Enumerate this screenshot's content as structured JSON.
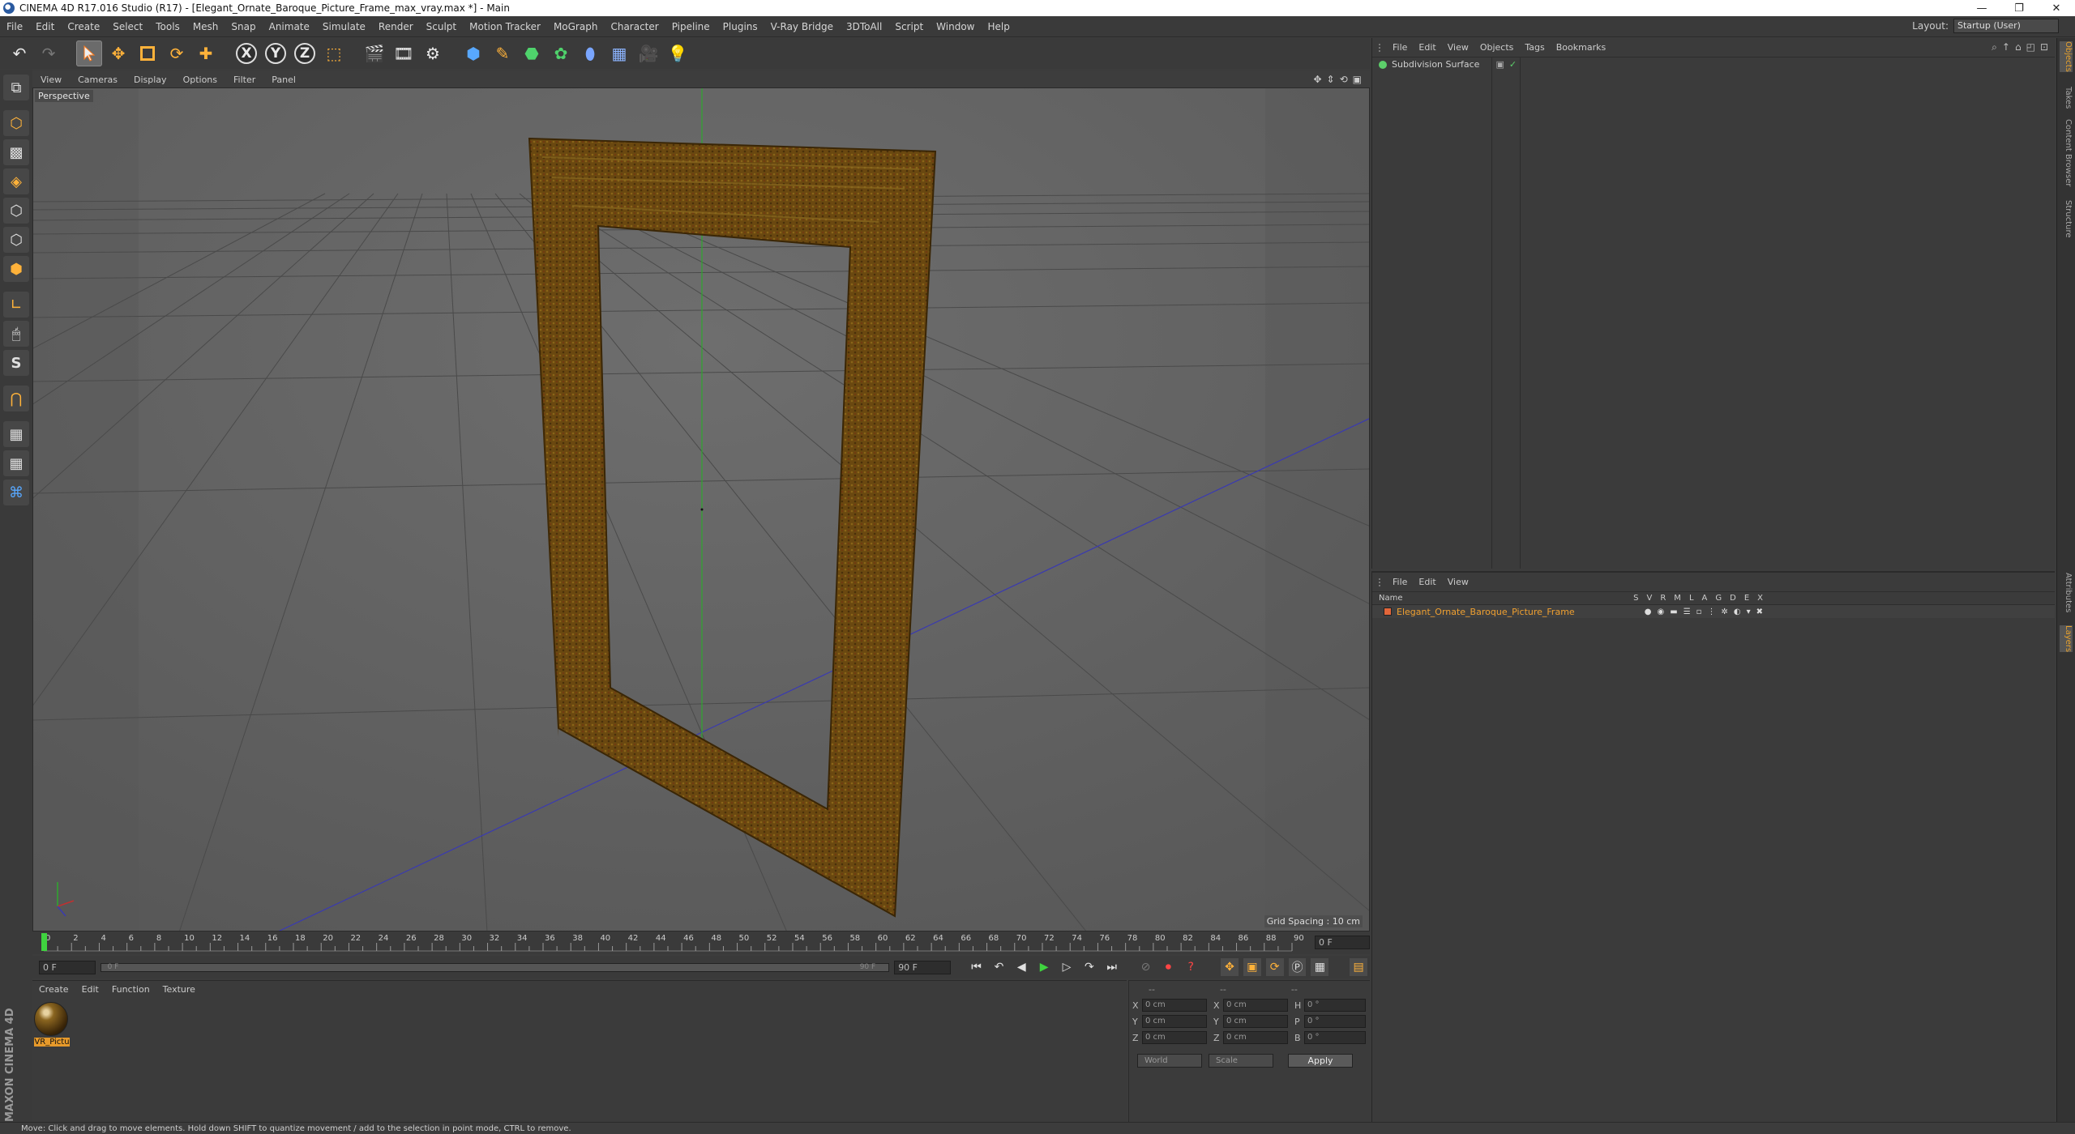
{
  "window": {
    "title": "CINEMA 4D R17.016 Studio (R17) - [Elegant_Ornate_Baroque_Picture_Frame_max_vray.max *] - Main",
    "buttons": [
      "—",
      "❐",
      "✕"
    ]
  },
  "menubar": {
    "items": [
      "File",
      "Edit",
      "Create",
      "Select",
      "Tools",
      "Mesh",
      "Snap",
      "Animate",
      "Simulate",
      "Render",
      "Sculpt",
      "Motion Tracker",
      "MoGraph",
      "Character",
      "Pipeline",
      "Plugins",
      "V-Ray Bridge",
      "3DToAll",
      "Script",
      "Window",
      "Help"
    ],
    "layout_label": "Layout:",
    "layout_value": "Startup (User)"
  },
  "viewport": {
    "menu": [
      "View",
      "Cameras",
      "Display",
      "Options",
      "Filter",
      "Panel"
    ],
    "label": "Perspective",
    "grid_spacing": "Grid Spacing : 10 cm"
  },
  "timeline": {
    "ticks": [
      0,
      2,
      4,
      6,
      8,
      10,
      12,
      14,
      16,
      18,
      20,
      22,
      24,
      26,
      28,
      30,
      32,
      34,
      36,
      38,
      40,
      42,
      44,
      46,
      48,
      50,
      52,
      54,
      56,
      58,
      60,
      62,
      64,
      66,
      68,
      70,
      72,
      74,
      76,
      78,
      80,
      82,
      84,
      86,
      88,
      90
    ],
    "current_frame": "0 F",
    "start_field": "0 F",
    "slider_start": "0 F",
    "slider_end": "90 F",
    "end_field": "90 F"
  },
  "material_panel": {
    "menu": [
      "Create",
      "Edit",
      "Function",
      "Texture"
    ],
    "material_name": "VR_Pictu"
  },
  "coord_panel": {
    "heads": [
      "--",
      "--",
      "--"
    ],
    "rows": [
      {
        "a": "X",
        "v1": "0 cm",
        "b": "X",
        "v2": "0 cm",
        "c": "H",
        "v3": "0 °"
      },
      {
        "a": "Y",
        "v1": "0 cm",
        "b": "Y",
        "v2": "0 cm",
        "c": "P",
        "v3": "0 °"
      },
      {
        "a": "Z",
        "v1": "0 cm",
        "b": "Z",
        "v2": "0 cm",
        "c": "B",
        "v3": "0 °"
      }
    ],
    "mode_world": "World",
    "mode_scale": "Scale",
    "apply": "Apply"
  },
  "object_manager": {
    "menu": [
      "File",
      "Edit",
      "View",
      "Objects",
      "Tags",
      "Bookmarks"
    ],
    "objects": [
      "Subdivision Surface"
    ]
  },
  "layer_manager": {
    "menu": [
      "File",
      "Edit",
      "View"
    ],
    "name_header": "Name",
    "flags": [
      "S",
      "V",
      "R",
      "M",
      "L",
      "A",
      "G",
      "D",
      "E",
      "X"
    ],
    "layers": [
      "Elegant_Ornate_Baroque_Picture_Frame"
    ]
  },
  "side_tabs": [
    "Objects",
    "Takes",
    "Content Browser",
    "Structure",
    "Attributes",
    "Layers"
  ],
  "status": "Move: Click and drag to move elements. Hold down SHIFT to quantize movement / add to the selection in point mode, CTRL to remove.",
  "brand": "MAXON CINEMA 4D",
  "colors": {
    "accent": "#e79a2b",
    "play": "#3fd43f",
    "record": "#ff4545",
    "frame_wood": "#6b4a12"
  }
}
